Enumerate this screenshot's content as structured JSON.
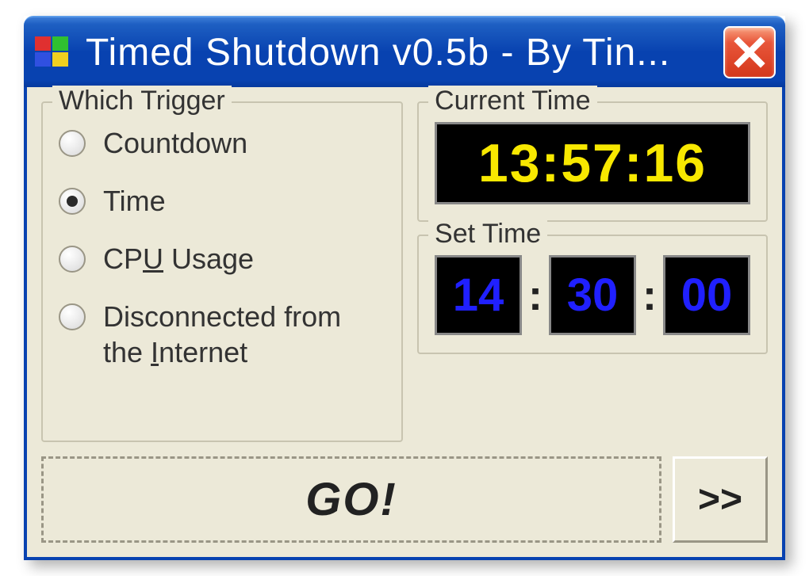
{
  "window": {
    "title": "Timed Shutdown v0.5b - By Tin..."
  },
  "trigger": {
    "legend": "Which Trigger",
    "options": {
      "countdown": "Countdown",
      "time": "Time",
      "cpu_prefix": "CP",
      "cpu_uline": "U",
      "cpu_suffix": " Usage",
      "disconnected_prefix": "Disconnected from the ",
      "disconnected_uline": "I",
      "disconnected_suffix": "nternet"
    },
    "selected": "time"
  },
  "current_time": {
    "legend": "Current Time",
    "value": "13:57:16"
  },
  "set_time": {
    "legend": "Set Time",
    "hours": "14",
    "minutes": "30",
    "seconds": "00",
    "colon": ":"
  },
  "buttons": {
    "go": "GO!",
    "expand": ">>"
  }
}
